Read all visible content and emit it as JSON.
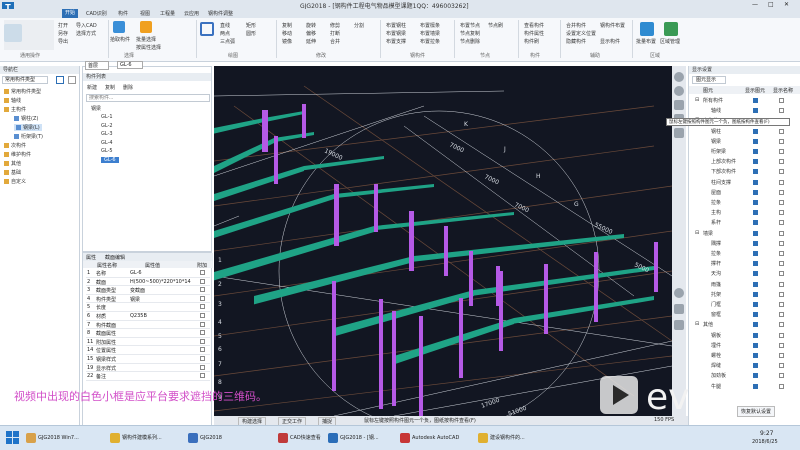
{
  "window": {
    "title": "GJG2018 - [钢构件工程电气物品模型课题1QQ：496003262]",
    "app_icon_letter": "T"
  },
  "menu": {
    "tabs": [
      "开始",
      "CAD识别",
      "构件",
      "视图",
      "工程量",
      "云应用",
      "钢构件调整"
    ],
    "active_index": 0
  },
  "ribbon": {
    "groups": [
      {
        "label": "通用操作",
        "items": [
          "打开",
          "另存",
          "导出",
          "导入CAD",
          "选择方式"
        ]
      },
      {
        "label": "选择",
        "items": [
          "拾取构件",
          "批量选择",
          "按属性选择"
        ]
      },
      {
        "label": "绘图",
        "items": [
          "直线",
          "两点",
          "三点弧",
          "矩形",
          "圆形"
        ]
      },
      {
        "label": "修改",
        "items": [
          "复制",
          "移动",
          "镜像",
          "旋转",
          "偏移",
          "延伸",
          "修剪",
          "打断",
          "合并",
          "分割"
        ]
      },
      {
        "label": "钢构件",
        "items": [
          "布置钢柱",
          "布置钢梁",
          "布置支撑",
          "布置檩条",
          "布置墙梁",
          "布置拉条"
        ]
      },
      {
        "label": "节点",
        "items": [
          "布置节点",
          "节点复制",
          "节点删除",
          "节点刷"
        ]
      },
      {
        "label": "构件",
        "items": [
          "查看构件",
          "构件属性",
          "构件刷"
        ]
      },
      {
        "label": "辅助",
        "items": [
          "合并构件",
          "设置定义位置",
          "隐藏构件",
          "显示构件",
          "钢构件布置"
        ]
      },
      {
        "label": "区域",
        "items": [
          "批量布置",
          "区域管理"
        ]
      }
    ]
  },
  "left_panel": {
    "header": "导航栏",
    "tabs": [
      "常用构件类型"
    ],
    "tree": [
      {
        "label": "常用构件类型",
        "level": 0
      },
      {
        "label": "轴线",
        "level": 0
      },
      {
        "label": "主构件",
        "level": 0
      },
      {
        "label": "钢柱(Z)",
        "level": 1
      },
      {
        "label": "钢梁(L)",
        "level": 1,
        "selected": true
      },
      {
        "label": "桁架梁(T)",
        "level": 1
      },
      {
        "label": "次构件",
        "level": 0
      },
      {
        "label": "维护构件",
        "level": 0
      },
      {
        "label": "其他",
        "level": 0
      },
      {
        "label": "基础",
        "level": 0
      },
      {
        "label": "自定义",
        "level": 0
      }
    ]
  },
  "component_list": {
    "header": "构件列表",
    "toolbar": [
      "新建",
      "复制",
      "删除"
    ],
    "search_placeholder": "搜索构件...",
    "group": "钢梁",
    "items": [
      "GL-1",
      "GL-2",
      "GL-3",
      "GL-4",
      "GL-5",
      "GL-6"
    ],
    "selected": "GL-6",
    "floor": "首层",
    "current": "GL-6"
  },
  "properties": {
    "tabs": [
      "属性",
      "截面编辑"
    ],
    "headers": [
      "属性名称",
      "属性值",
      "附加"
    ],
    "rows": [
      {
        "no": "1",
        "name": "名称",
        "value": "GL-6"
      },
      {
        "no": "2",
        "name": "截面",
        "value": "H(500~500)*220*10*14"
      },
      {
        "no": "3",
        "name": "截面类型",
        "value": "变截面"
      },
      {
        "no": "4",
        "name": "构件类型",
        "value": "钢梁"
      },
      {
        "no": "5",
        "name": "长度",
        "value": ""
      },
      {
        "no": "6",
        "name": "材质",
        "value": "Q235B"
      },
      {
        "no": "7",
        "name": "构件截面",
        "value": ""
      },
      {
        "no": "8",
        "name": "截面属性",
        "value": ""
      },
      {
        "no": "11",
        "name": "附加属性",
        "value": ""
      },
      {
        "no": "14",
        "name": "位置属性",
        "value": ""
      },
      {
        "no": "15",
        "name": "钢梁样式",
        "value": ""
      },
      {
        "no": "19",
        "name": "显示样式",
        "value": ""
      },
      {
        "no": "22",
        "name": "备注",
        "value": ""
      }
    ]
  },
  "viewport": {
    "dims": [
      "19000",
      "7000",
      "7000",
      "7000",
      "55000",
      "5000",
      "17000",
      "51000"
    ],
    "axis_letters_top": [
      "K",
      "J",
      "H",
      "G"
    ],
    "axis_numbers": [
      "1",
      "2",
      "3",
      "4",
      "5",
      "6",
      "7",
      "8",
      "9",
      "A",
      "B",
      "C",
      "D",
      "E",
      "F"
    ]
  },
  "right_panel": {
    "header": "显示设置",
    "tab": "图元显示",
    "columns": [
      "图元",
      "显示图元",
      "显示名称"
    ],
    "tooltip": "鼠标左键按照构件图元一个负，图纸按构件查看(F)",
    "items": [
      {
        "label": "所有构件",
        "level": 0,
        "show": true,
        "name": false
      },
      {
        "label": "轴线",
        "level": 1,
        "show": true,
        "name": false
      },
      {
        "label": "主构件",
        "level": 0,
        "show": true,
        "name": false
      },
      {
        "label": "钢柱",
        "level": 1,
        "show": true,
        "name": false
      },
      {
        "label": "钢梁",
        "level": 1,
        "show": true,
        "name": false
      },
      {
        "label": "桁架梁",
        "level": 1,
        "show": true,
        "name": false
      },
      {
        "label": "上部次构件",
        "level": 1,
        "show": true,
        "name": false
      },
      {
        "label": "下部次构件",
        "level": 1,
        "show": true,
        "name": false
      },
      {
        "label": "柱间支撑",
        "level": 1,
        "show": true,
        "name": false
      },
      {
        "label": "屋面",
        "level": 1,
        "show": true,
        "name": false
      },
      {
        "label": "拉条",
        "level": 1,
        "show": true,
        "name": false
      },
      {
        "label": "主构",
        "level": 1,
        "show": true,
        "name": false
      },
      {
        "label": "系杆",
        "level": 1,
        "show": true,
        "name": false
      },
      {
        "label": "墙梁",
        "level": 0,
        "show": true,
        "name": false
      },
      {
        "label": "隅撑",
        "level": 1,
        "show": true,
        "name": false
      },
      {
        "label": "拉条",
        "level": 1,
        "show": true,
        "name": false
      },
      {
        "label": "撑杆",
        "level": 1,
        "show": true,
        "name": false
      },
      {
        "label": "天沟",
        "level": 1,
        "show": true,
        "name": false
      },
      {
        "label": "雨篷",
        "level": 1,
        "show": true,
        "name": false
      },
      {
        "label": "托架",
        "level": 1,
        "show": true,
        "name": false
      },
      {
        "label": "门框",
        "level": 1,
        "show": true,
        "name": false
      },
      {
        "label": "窗框",
        "level": 1,
        "show": true,
        "name": false
      },
      {
        "label": "其他",
        "level": 0,
        "show": true,
        "name": false
      },
      {
        "label": "钢板",
        "level": 1,
        "show": true,
        "name": false
      },
      {
        "label": "埋件",
        "level": 1,
        "show": true,
        "name": false
      },
      {
        "label": "螺栓",
        "level": 1,
        "show": true,
        "name": false
      },
      {
        "label": "焊缝",
        "level": 1,
        "show": true,
        "name": false
      },
      {
        "label": "加劲板",
        "level": 1,
        "show": true,
        "name": false
      },
      {
        "label": "牛腿",
        "level": 1,
        "show": true,
        "name": false
      }
    ],
    "footer": "恢复默认设置"
  },
  "statusbar": {
    "tabs": [
      "构建选择",
      "正交工作",
      "捕捉"
    ],
    "hint": "鼠标左键按照构件图元一个负，图纸按构件查看(F)",
    "fps": "150 FPS"
  },
  "subtitle": "视频中出现的白色小框是应平台要求遮挡的三维码。",
  "watermark_text": "ev",
  "taskbar": {
    "items": [
      "GJG2018 Win7...",
      "钢构件建模系列...",
      "GJG2018",
      "CAD快速查看",
      "GJG2018 - [钢...",
      "Autodesk AutoCAD",
      "建设钢构件的..."
    ],
    "time": "9:27",
    "date": "2018/6/25"
  },
  "colors": {
    "beam": "#1fa386",
    "column": "#b55ae6",
    "background": "#121622",
    "subtitle": "#d24ec8",
    "accent": "#2d6fb5"
  }
}
